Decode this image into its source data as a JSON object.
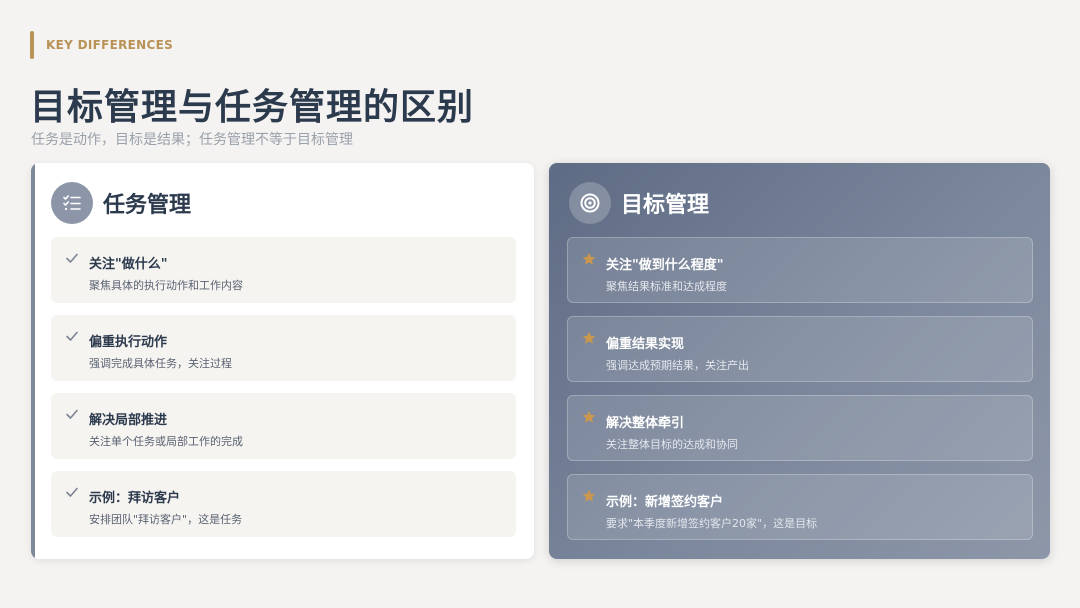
{
  "kicker": "KEY DIFFERENCES",
  "title": "目标管理与任务管理的区别",
  "subtitle": "任务是动作，目标是结果；任务管理不等于目标管理",
  "colors": {
    "accent": "#b89256",
    "heading": "#2c3a4d",
    "right_card_bg": "#6f7b90",
    "star": "#c9974e"
  },
  "task_card": {
    "icon": "checklist-icon",
    "title": "任务管理",
    "items": [
      {
        "icon": "check-icon",
        "title": "关注\"做什么\"",
        "desc": "聚焦具体的执行动作和工作内容"
      },
      {
        "icon": "check-icon",
        "title": "偏重执行动作",
        "desc": "强调完成具体任务，关注过程"
      },
      {
        "icon": "check-icon",
        "title": "解决局部推进",
        "desc": "关注单个任务或局部工作的完成"
      },
      {
        "icon": "check-icon",
        "title": "示例：拜访客户",
        "desc": "安排团队\"拜访客户\"，这是任务"
      }
    ]
  },
  "goal_card": {
    "icon": "target-icon",
    "title": "目标管理",
    "items": [
      {
        "icon": "star-icon",
        "title": "关注\"做到什么程度\"",
        "desc": "聚焦结果标准和达成程度"
      },
      {
        "icon": "star-icon",
        "title": "偏重结果实现",
        "desc": "强调达成预期结果，关注产出"
      },
      {
        "icon": "star-icon",
        "title": "解决整体牵引",
        "desc": "关注整体目标的达成和协同"
      },
      {
        "icon": "star-icon",
        "title": "示例：新增签约客户",
        "desc": "要求\"本季度新增签约客户20家\"，这是目标"
      }
    ]
  }
}
